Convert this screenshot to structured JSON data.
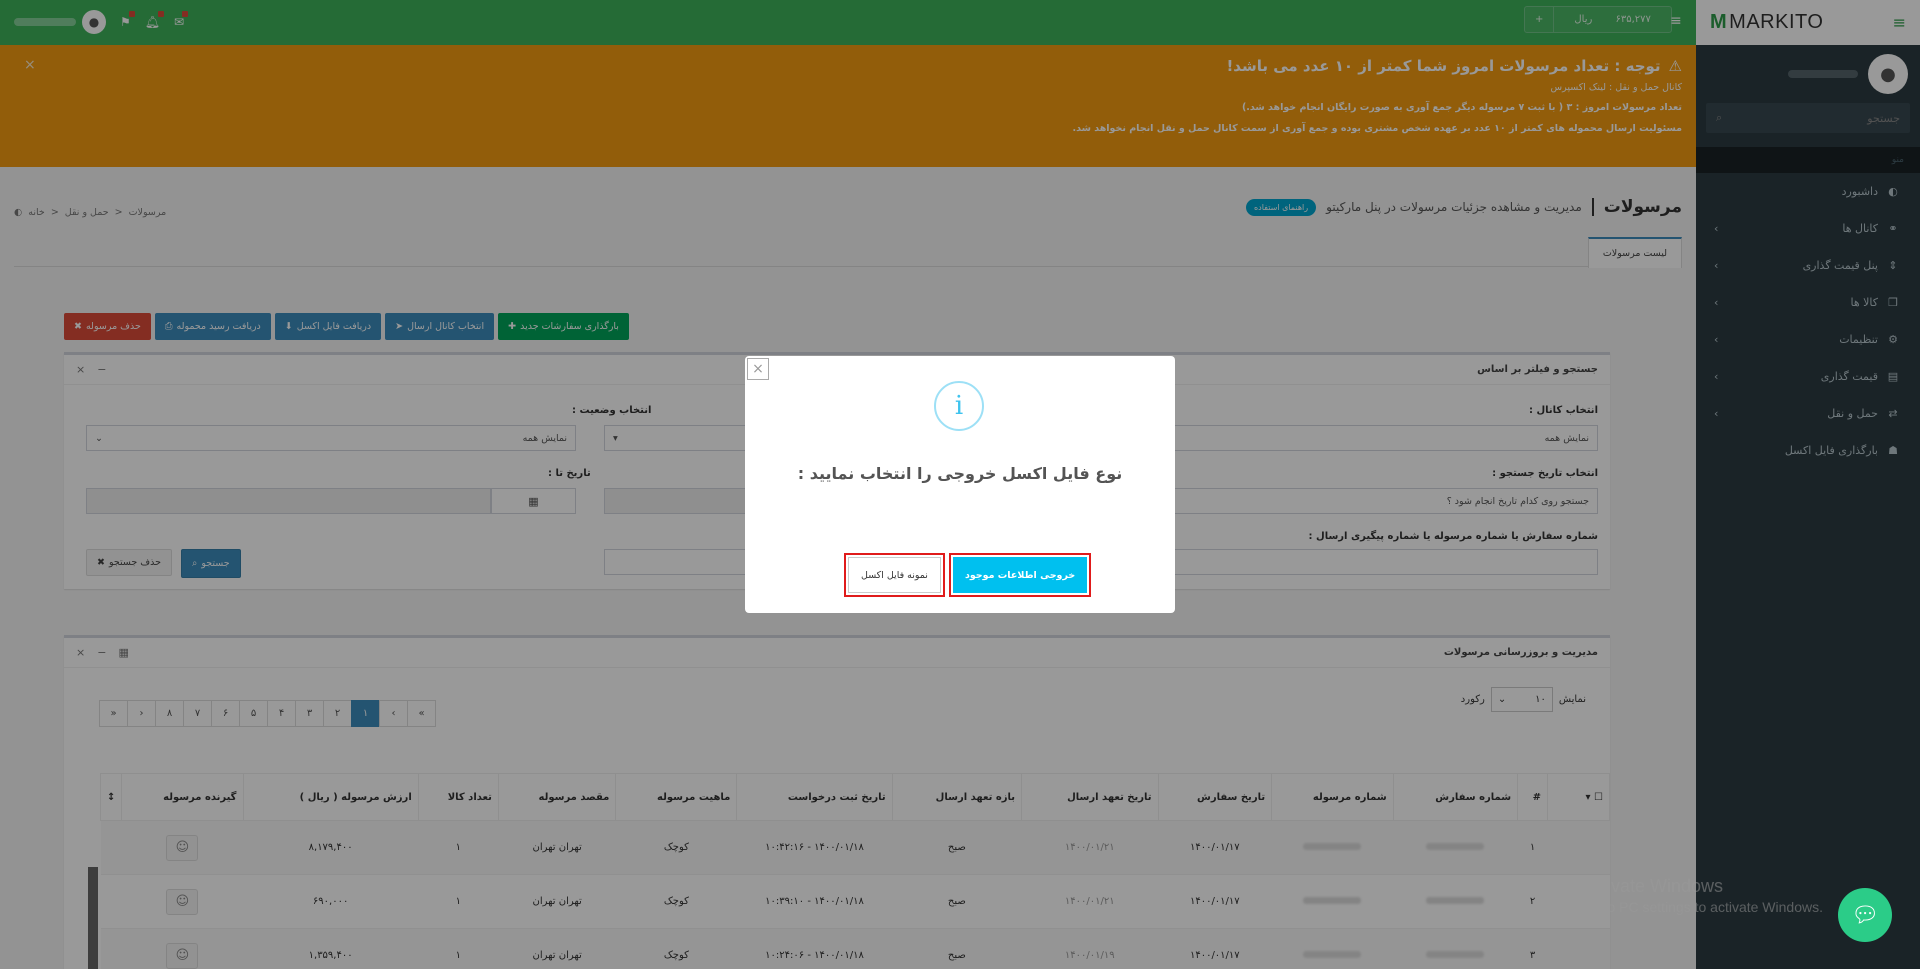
{
  "brand": {
    "name": "MARKITO"
  },
  "topbar": {
    "wallet_amount": "۶۳۵,۲۷۷",
    "wallet_currency": "ریال",
    "add_label": "+",
    "menu_icon": "hamburger-icon"
  },
  "sidebar": {
    "search_placeholder": "جستجو",
    "section_label": "منو",
    "items": [
      {
        "label": "داشبورد",
        "icon": "dashboard-icon",
        "ic": "◐",
        "has_arrow": false
      },
      {
        "label": "کانال ها",
        "icon": "link-icon",
        "ic": "⚭",
        "has_arrow": true
      },
      {
        "label": "پنل قیمت گذاری",
        "icon": "sort-icon",
        "ic": "⇕",
        "has_arrow": true
      },
      {
        "label": "کالا ها",
        "icon": "cubes-icon",
        "ic": "❒",
        "has_arrow": true
      },
      {
        "label": "تنظیمات",
        "icon": "gear-icon",
        "ic": "⚙",
        "has_arrow": true
      },
      {
        "label": "قیمت گذاری",
        "icon": "chart-icon",
        "ic": "▤",
        "has_arrow": true
      },
      {
        "label": "حمل و نقل",
        "icon": "exchange-icon",
        "ic": "⇄",
        "has_arrow": true
      },
      {
        "label": "بارگذاری فایل اکسل",
        "icon": "user-upload-icon",
        "ic": "☗",
        "has_arrow": false
      }
    ]
  },
  "warning": {
    "title": "توجه : تعداد مرسولات امروز شما کمتر از ۱۰ عدد می باشد!",
    "line1": "کانال حمل و نقل : لینک اکسپرس",
    "line2": "تعداد مرسولات امروز : ۳ ( با ثبت ۷ مرسوله دیگر جمع آوری به صورت رایگان انجام خواهد شد.)",
    "line3": "مسئولیت ارسال محموله های کمتر از ۱۰ عدد بر عهده شخص مشتری بوده و جمع آوری از سمت کانال حمل و نقل انجام نخواهد شد."
  },
  "page": {
    "title": "مرسولات",
    "subtitle": "مدیریت و مشاهده جزئیات مرسولات در پنل مارکیتو",
    "help_badge": "راهنمای استفاده",
    "breadcrumb": [
      "خانه",
      "حمل و نقل",
      "مرسولات"
    ],
    "tab": "لیست مرسولات"
  },
  "actions": {
    "upload_new": "بارگذاری سفارشات جدید",
    "select_channel": "انتخاب کانال ارسال",
    "get_excel": "دریافت فایل اکسل",
    "get_receipt": "دریافت رسید محموله",
    "delete": "حذف مرسوله"
  },
  "filter": {
    "title": "جستجو و فیلتر بر اساس",
    "channel_label": "انتخاب کانال :",
    "channel_value": "نمایش همه",
    "status_label": "انتخاب وضعیت :",
    "status_value": "نمایش همه",
    "date_search_label": "انتخاب تاریخ جستجو :",
    "date_search_value": "جستجو روی کدام تاریخ انجام شود ؟",
    "date_to_label": "تاریخ تا :",
    "order_label": "شماره سفارش یا شماره مرسوله یا شماره پیگیری ارسال :",
    "search_btn": "جستجو",
    "clear_btn": "حذف جستجو"
  },
  "manage": {
    "title": "مدیریت و بروزرسانی مرسولات",
    "show_label": "نمایش",
    "per_page": "۱۰",
    "record_label": "رکورد",
    "pages": [
      "«",
      "‹",
      "۱",
      "۲",
      "۳",
      "۴",
      "۵",
      "۶",
      "۷",
      "۸",
      "›",
      "»"
    ],
    "columns": [
      "#",
      "شماره سفارش",
      "شماره مرسوله",
      "تاریخ سفارش",
      "تاریخ تعهد ارسال",
      "بازه تعهد ارسال",
      "تاریخ ثبت درخواست",
      "ماهیت مرسوله",
      "مقصد مرسوله",
      "تعداد کالا",
      "ارزش مرسوله ( ریال )",
      "گیرنده مرسوله"
    ],
    "rows": [
      {
        "n": "۱",
        "order_date": "۱۴۰۰/۰۱/۱۷",
        "commit_date": "۱۴۰۰/۰۱/۲۱",
        "window": "صبح",
        "req": "۱۴۰۰/۰۱/۱۸ - ۱۰:۴۲:۱۶",
        "kind": "کوچک",
        "dest": "تهران تهران",
        "qty": "۱",
        "value": "۸,۱۷۹,۴۰۰"
      },
      {
        "n": "۲",
        "order_date": "۱۴۰۰/۰۱/۱۷",
        "commit_date": "۱۴۰۰/۰۱/۲۱",
        "window": "صبح",
        "req": "۱۴۰۰/۰۱/۱۸ - ۱۰:۳۹:۱۰",
        "kind": "کوچک",
        "dest": "تهران تهران",
        "qty": "۱",
        "value": "۶۹۰,۰۰۰"
      },
      {
        "n": "۳",
        "order_date": "۱۴۰۰/۰۱/۱۷",
        "commit_date": "۱۴۰۰/۰۱/۱۹",
        "window": "صبح",
        "req": "۱۴۰۰/۰۱/۱۸ - ۱۰:۲۴:۰۶",
        "kind": "کوچک",
        "dest": "تهران تهران",
        "qty": "۱",
        "value": "۱,۳۵۹,۴۰۰"
      }
    ]
  },
  "modal": {
    "info_glyph": "i",
    "message": "نوع فایل اکسل خروجی را انتخاب نمایید :",
    "btn_export": "خروجی اطلاعات موجود",
    "btn_sample": "نمونه فایل اکسل",
    "close": "×"
  },
  "watermark": {
    "line1": "Activate Windows",
    "line2": "Go to PC settings to activate Windows."
  }
}
